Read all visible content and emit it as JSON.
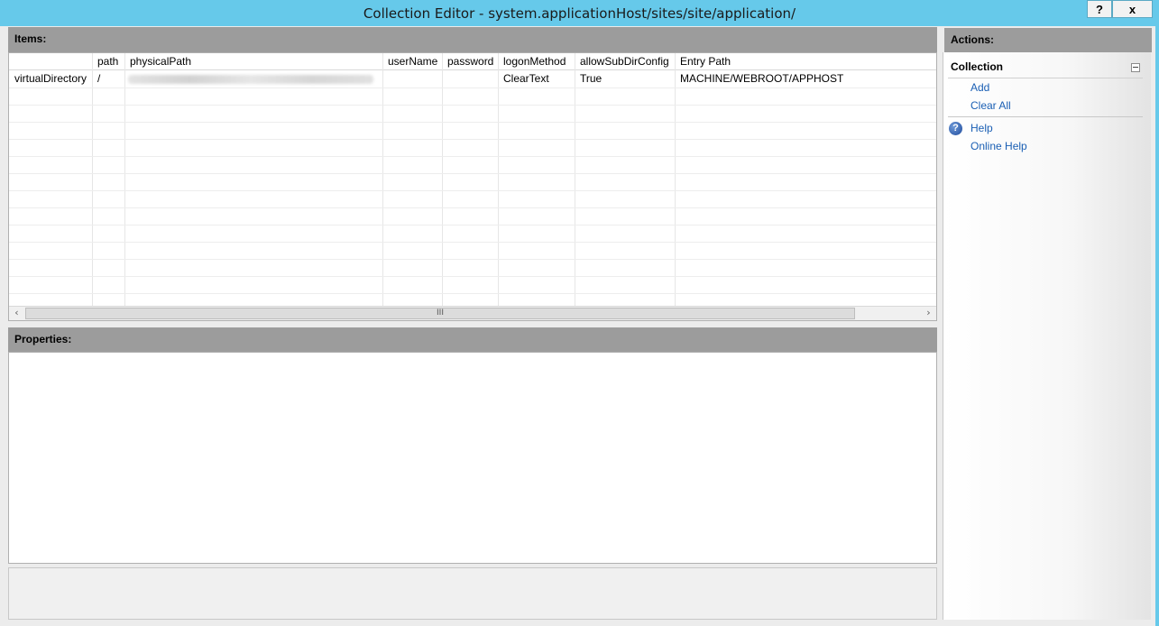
{
  "window": {
    "title": "Collection Editor - system.applicationHost/sites/site/application/",
    "help_label": "?",
    "close_label": "x"
  },
  "items": {
    "header": "Items:",
    "columns": [
      "",
      "path",
      "physicalPath",
      "userName",
      "password",
      "logonMethod",
      "allowSubDirConfig",
      "Entry Path"
    ],
    "rows": [
      [
        "virtualDirectory",
        "/",
        "",
        "",
        "",
        "ClearText",
        "True",
        "MACHINE/WEBROOT/APPHOST"
      ]
    ],
    "scroll_left_icon": "chevron-left-icon",
    "scroll_right_icon": "chevron-right-icon",
    "scroll_thumb_grip": "III"
  },
  "properties": {
    "header": "Properties:"
  },
  "actions": {
    "header": "Actions:",
    "group_title": "Collection",
    "add_label": "Add",
    "clear_all_label": "Clear All",
    "help_label": "Help",
    "online_help_label": "Online Help",
    "help_icon_glyph": "?"
  },
  "colors": {
    "titlebar": "#66c9ea",
    "panel_header": "#9c9c9c",
    "link": "#1a5fb4"
  }
}
